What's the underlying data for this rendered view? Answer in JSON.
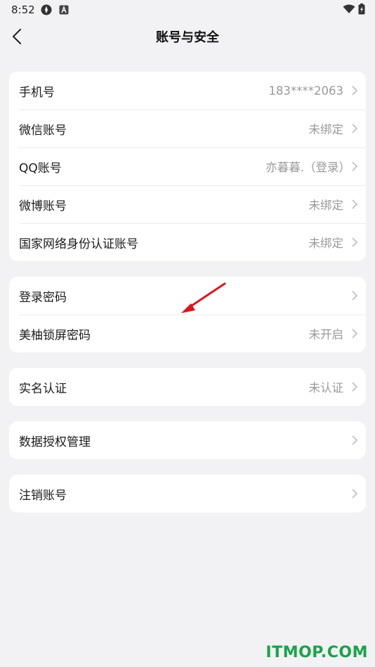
{
  "status_bar": {
    "time": "8:52",
    "icons": [
      "compass-icon",
      "a-badge-icon",
      "wifi-icon",
      "battery-charging-icon"
    ]
  },
  "header": {
    "title": "账号与安全",
    "back_icon": "chevron-left-icon"
  },
  "groups": [
    {
      "rows": [
        {
          "label": "手机号",
          "value": "183****2063"
        },
        {
          "label": "微信账号",
          "value": "未绑定"
        },
        {
          "label": "QQ账号",
          "value": "亦暮暮.（登录）"
        },
        {
          "label": "微博账号",
          "value": "未绑定"
        },
        {
          "label": "国家网络身份认证账号",
          "value": "未绑定"
        }
      ]
    },
    {
      "rows": [
        {
          "label": "登录密码",
          "value": ""
        },
        {
          "label": "美柚锁屏密码",
          "value": "未开启"
        }
      ]
    },
    {
      "rows": [
        {
          "label": "实名认证",
          "value": "未认证"
        }
      ]
    },
    {
      "rows": [
        {
          "label": "数据授权管理",
          "value": ""
        }
      ]
    },
    {
      "rows": [
        {
          "label": "注销账号",
          "value": ""
        }
      ]
    }
  ],
  "watermark": "ITMOP.COM",
  "colors": {
    "background": "#f2f2f4",
    "card": "#ffffff",
    "value_text": "#9a9a9a",
    "chevron": "#bdbdbd",
    "arrow": "#e0141e",
    "watermark": "#1aa34a"
  }
}
